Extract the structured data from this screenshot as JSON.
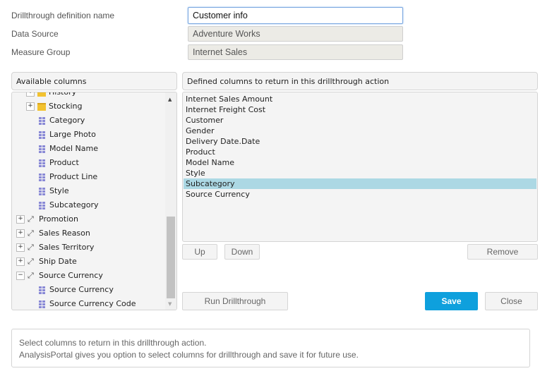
{
  "form": {
    "name_label": "Drillthrough definition name",
    "name_value": "Customer info",
    "source_label": "Data Source",
    "source_value": "Adventure Works",
    "measure_label": "Measure Group",
    "measure_value": "Internet Sales"
  },
  "available": {
    "header": "Available columns",
    "items": [
      {
        "label": "History",
        "type": "folder",
        "level": 1,
        "expander": "+"
      },
      {
        "label": "Stocking",
        "type": "folder",
        "level": 1,
        "expander": "+"
      },
      {
        "label": "Category",
        "type": "attribute",
        "level": 2
      },
      {
        "label": "Large Photo",
        "type": "attribute",
        "level": 2
      },
      {
        "label": "Model Name",
        "type": "attribute",
        "level": 2
      },
      {
        "label": "Product",
        "type": "attribute",
        "level": 2
      },
      {
        "label": "Product Line",
        "type": "attribute",
        "level": 2
      },
      {
        "label": "Style",
        "type": "attribute",
        "level": 2
      },
      {
        "label": "Subcategory",
        "type": "attribute",
        "level": 2
      },
      {
        "label": "Promotion",
        "type": "dimension",
        "level": 0,
        "expander": "+"
      },
      {
        "label": "Sales Reason",
        "type": "dimension",
        "level": 0,
        "expander": "+"
      },
      {
        "label": "Sales Territory",
        "type": "dimension",
        "level": 0,
        "expander": "+"
      },
      {
        "label": "Ship Date",
        "type": "dimension",
        "level": 0,
        "expander": "+"
      },
      {
        "label": "Source Currency",
        "type": "dimension",
        "level": 0,
        "expander": "−"
      },
      {
        "label": "Source Currency",
        "type": "attribute",
        "level": 2
      },
      {
        "label": "Source Currency Code",
        "type": "attribute",
        "level": 2
      }
    ]
  },
  "defined": {
    "header": "Defined columns to return in this drillthrough action",
    "items": [
      "Internet Sales Amount",
      "Internet Freight Cost",
      "Customer",
      "Gender",
      "Delivery Date.Date",
      "Product",
      "Model Name",
      "Style",
      "Subcategory",
      "Source Currency"
    ],
    "selected": "Subcategory"
  },
  "buttons": {
    "up": "Up",
    "down": "Down",
    "remove": "Remove",
    "run": "Run Drillthrough",
    "save": "Save",
    "close": "Close"
  },
  "info": {
    "line1": "Select columns to return in this drillthrough action.",
    "line2": "AnalysisPortal gives you option to select columns for drillthrough and save it for future use."
  },
  "colors": {
    "accent": "#0ea0dd",
    "selection": "#acd8e4"
  }
}
